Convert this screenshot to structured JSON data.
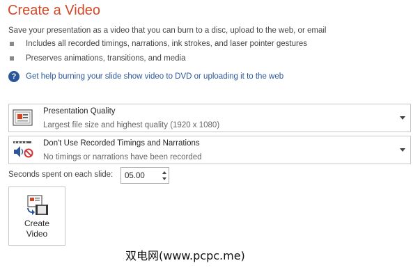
{
  "header": {
    "title": "Create a Video"
  },
  "description": "Save your presentation as a video that you can burn to a disc, upload to the web, or email",
  "bullets": [
    "Includes all recorded timings, narrations, ink strokes, and laser pointer gestures",
    "Preserves animations, transitions, and media"
  ],
  "help_link": "Get help burning your slide show video to DVD or uploading it to the web",
  "quality_dropdown": {
    "title": "Presentation Quality",
    "subtitle": "Largest file size and highest quality (1920 x 1080)",
    "icon": "presentation-quality-icon"
  },
  "timings_dropdown": {
    "title": "Don't Use Recorded Timings and Narrations",
    "subtitle": "No timings or narrations have been recorded",
    "icon": "speaker-no-icon"
  },
  "seconds": {
    "label": "Seconds spent on each slide:",
    "value": "05.00"
  },
  "create_button": {
    "label": "Create\nVideo",
    "icon": "create-video-icon"
  },
  "watermark": "双电网(www.pcpc.me)",
  "colors": {
    "title": "#d24726",
    "link": "#2b579a",
    "border": "#c6c6c6"
  }
}
